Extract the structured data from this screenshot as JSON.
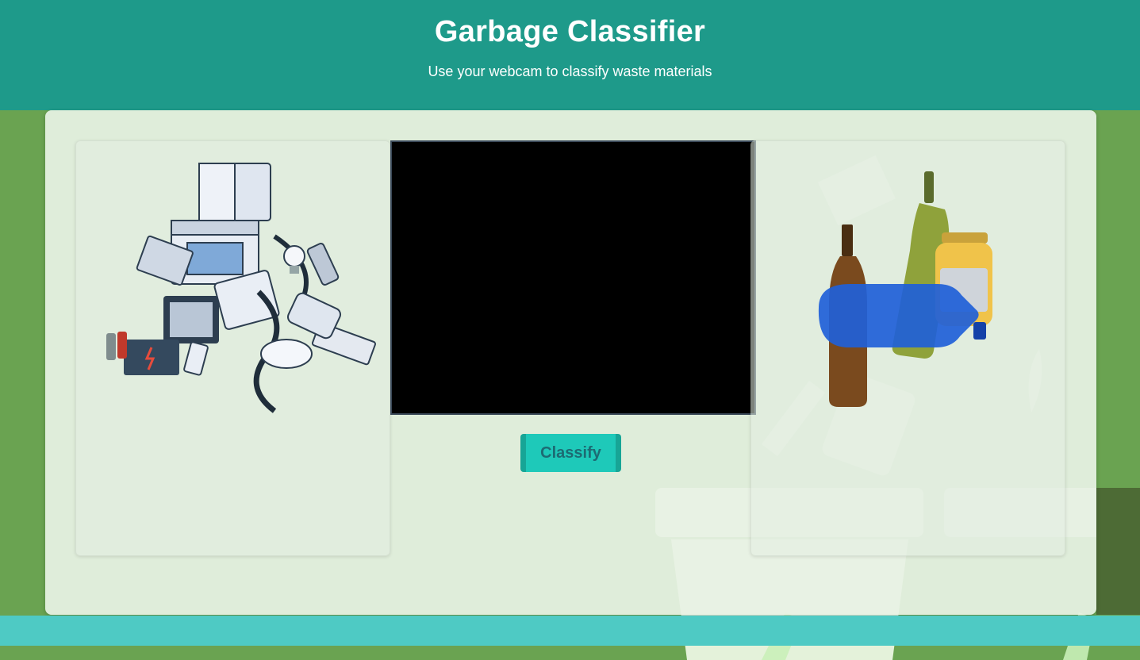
{
  "header": {
    "title": "Garbage Classifier",
    "subtitle": "Use your webcam to classify waste materials"
  },
  "classify_button": {
    "label": "Classify"
  },
  "panels": {
    "left_image": "e-waste-illustration",
    "right_image": "glass-bottles-illustration"
  },
  "colors": {
    "header_bg": "#1e9a8a",
    "page_bg": "#6aa351",
    "button_bg": "#1ec9b9",
    "footer_bg": "#4ecac4"
  }
}
